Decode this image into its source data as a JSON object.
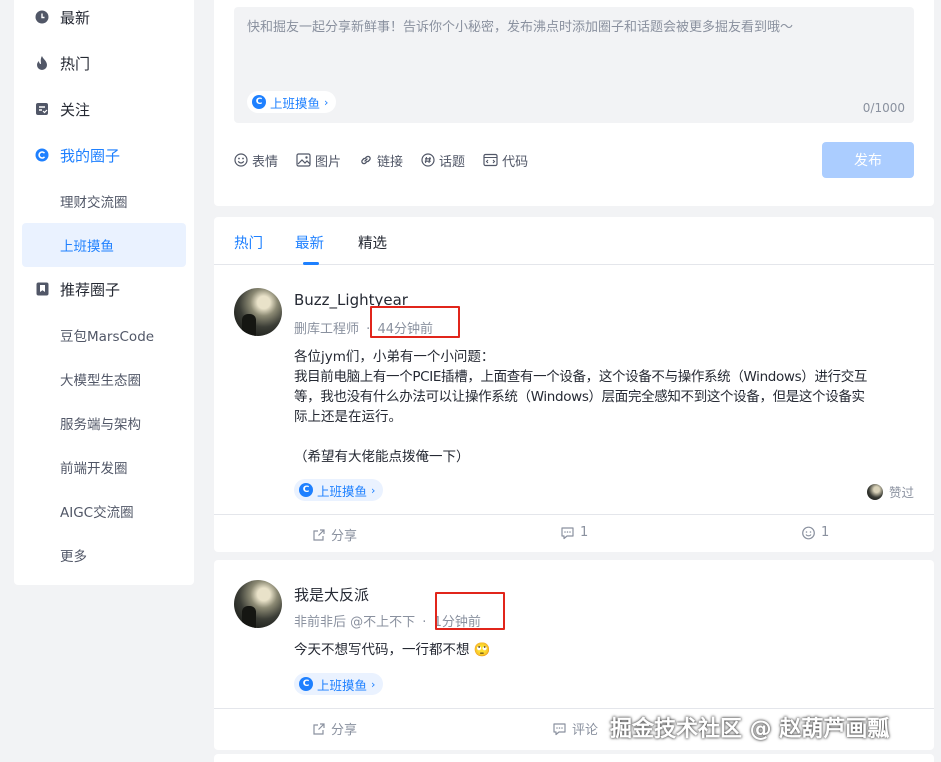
{
  "sidebar": {
    "items": [
      {
        "label": "最新",
        "icon": "clock-icon"
      },
      {
        "label": "热门",
        "icon": "flame-icon"
      },
      {
        "label": "关注",
        "icon": "follow-icon"
      },
      {
        "label": "我的圈子",
        "icon": "circle-logo-icon"
      }
    ],
    "my_circles": [
      {
        "label": "理财交流圈"
      },
      {
        "label": "上班摸鱼"
      }
    ],
    "recommend_title": "推荐圈子",
    "recommend_icon": "bookmark-icon",
    "recommended": [
      {
        "label": "豆包MarsCode"
      },
      {
        "label": "大模型生态圈"
      },
      {
        "label": "服务端与架构"
      },
      {
        "label": "前端开发圈"
      },
      {
        "label": "AIGC交流圈"
      },
      {
        "label": "更多"
      }
    ]
  },
  "composer": {
    "placeholder": "快和掘友一起分享新鲜事！告诉你个小秘密，发布沸点时添加圈子和话题会被更多掘友看到哦～",
    "circle_chip": "上班摸鱼",
    "counter": "0/1000",
    "tools": [
      {
        "label": "表情",
        "icon": "emoji-icon"
      },
      {
        "label": "图片",
        "icon": "image-icon"
      },
      {
        "label": "链接",
        "icon": "link-icon"
      },
      {
        "label": "话题",
        "icon": "hashtag-icon"
      },
      {
        "label": "代码",
        "icon": "code-icon"
      }
    ],
    "publish_label": "发布"
  },
  "feed": {
    "tabs": [
      {
        "label": "热门"
      },
      {
        "label": "最新"
      },
      {
        "label": "精选"
      }
    ],
    "active_tab": "最新",
    "posts": [
      {
        "author": "Buzz_Lightyear",
        "title_role": "删库工程师",
        "time": "44分钟前",
        "content_lines": [
          "各位jym们，小弟有一个小问题：",
          "我目前电脑上有一个PCIE插槽，上面查有一个设备，这个设备不与操作系统（Windows）进行交互",
          "等，我也没有什么办法可以让操作系统（Windows）层面完全感知不到这个设备，但是这个设备实",
          "际上还是在运行。",
          "",
          "（希望有大佬能点拨俺一下）"
        ],
        "circle": "上班摸鱼",
        "liked_label": "赞过",
        "share_label": "分享",
        "comment_count": "1",
        "like_count": "1"
      },
      {
        "author": "我是大反派",
        "title_role": "非前非后 @不上不下",
        "time": "1分钟前",
        "content": "今天不想写代码，一行都不想",
        "emoji": "🙄",
        "circle": "上班摸鱼",
        "share_label": "分享",
        "comment_label": "评论"
      }
    ]
  },
  "watermark": "掘金技术社区 @ 赵葫芦画瓢",
  "colors": {
    "brand": "#1e80ff",
    "publish_disabled": "#abcdff",
    "highlight_box": "#e1251b",
    "background": "#f2f3f5"
  }
}
